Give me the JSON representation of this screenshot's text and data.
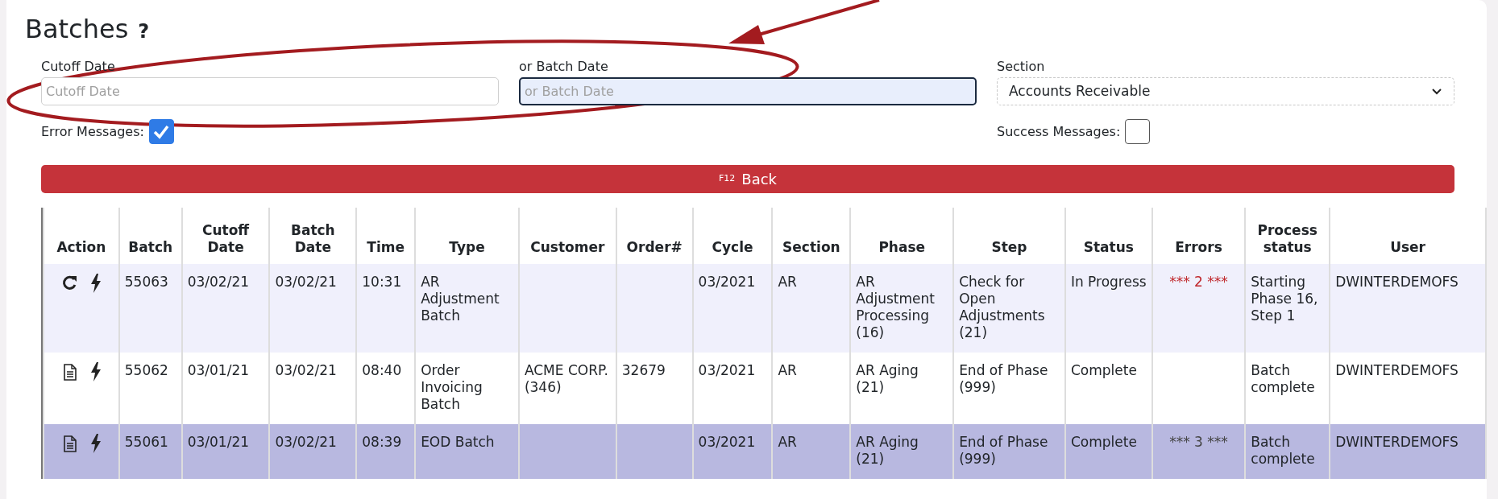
{
  "title": "Batches",
  "help": "?",
  "filters": {
    "cutoff_date": {
      "label": "Cutoff Date",
      "placeholder": "Cutoff Date",
      "focused": false
    },
    "batch_date": {
      "label": "or Batch Date",
      "placeholder": "or Batch Date",
      "focused": true
    },
    "section": {
      "label": "Section",
      "value": "Accounts Receivable"
    },
    "error_messages": {
      "label": "Error Messages:",
      "checked": true
    },
    "success_messages": {
      "label": "Success Messages:",
      "checked": false
    }
  },
  "back_button": {
    "shortcut": "F12",
    "label": "Back"
  },
  "table": {
    "columns": [
      "Action",
      "Batch",
      "Cutoff Date",
      "Batch Date",
      "Time",
      "Type",
      "Customer",
      "Order#",
      "Cycle",
      "Section",
      "Phase",
      "Step",
      "Status",
      "Errors",
      "Process status",
      "User"
    ],
    "rows": [
      {
        "kind": "refresh",
        "selected": false,
        "color": "#c0282d",
        "cells": [
          "",
          "55063",
          "03/02/21",
          "03/02/21",
          "10:31",
          "AR Adjustment Batch",
          "",
          "",
          "03/2021",
          "AR",
          "AR Adjustment Processing (16)",
          "Check for Open Adjustments (21)",
          "In Progress",
          "*** 2 ***",
          "Starting Phase 16, Step 1",
          "DWINTERDEMOFS"
        ]
      },
      {
        "kind": "document",
        "selected": false,
        "cells": [
          "",
          "55062",
          "03/01/21",
          "03/02/21",
          "08:40",
          "Order Invoicing Batch",
          "ACME CORP. (346)",
          "32679",
          "03/2021",
          "AR",
          "AR Aging (21)",
          "End of Phase (999)",
          "Complete",
          "",
          "Batch complete",
          "DWINTERDEMOFS"
        ]
      },
      {
        "kind": "document",
        "selected": true,
        "color": "#444444",
        "cells": [
          "",
          "55061",
          "03/01/21",
          "03/02/21",
          "08:39",
          "EOD Batch",
          "",
          "",
          "03/2021",
          "AR",
          "AR Aging (21)",
          "End of Phase (999)",
          "Complete",
          "*** 3 ***",
          "Batch complete",
          "DWINTERDEMOFS"
        ]
      }
    ]
  }
}
